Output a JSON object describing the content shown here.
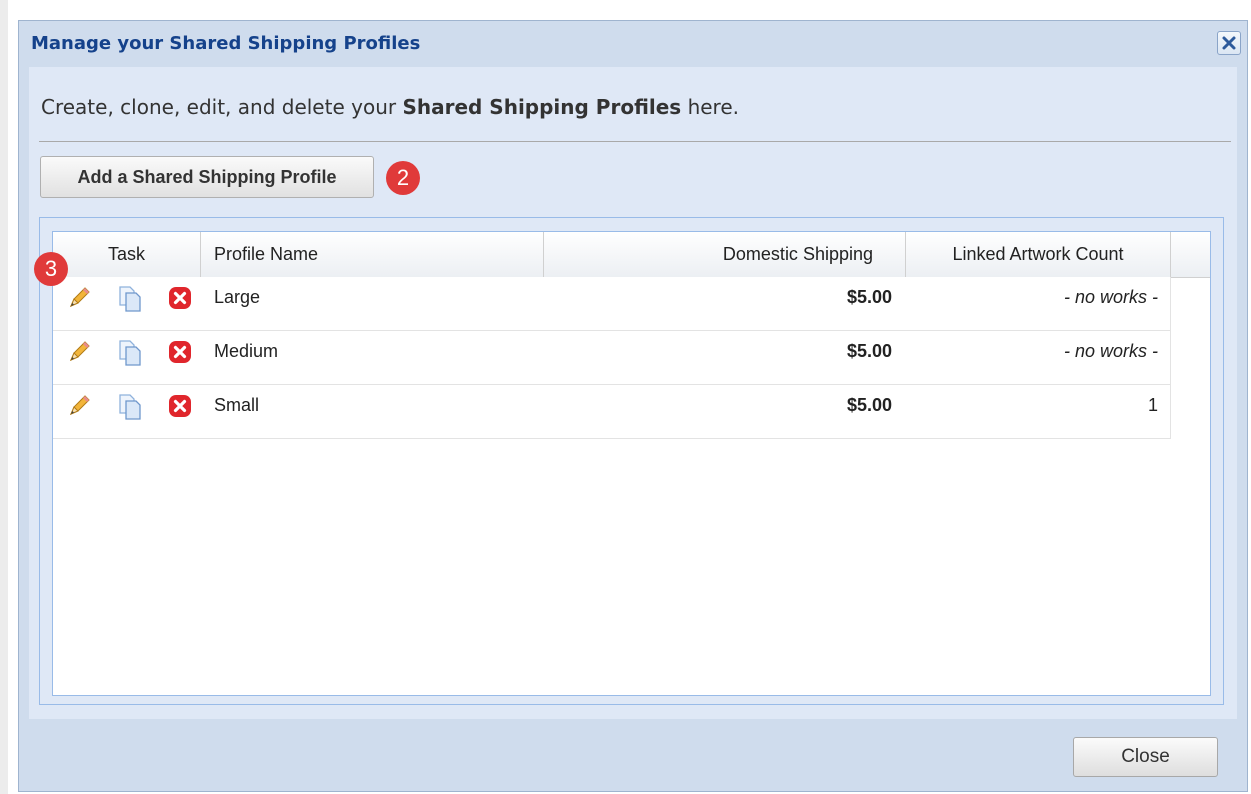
{
  "dialog": {
    "title": "Manage your Shared Shipping Profiles",
    "intro_prefix": "Create, clone, edit, and delete your ",
    "intro_bold": "Shared Shipping Profiles",
    "intro_suffix": " here.",
    "add_button_label": "Add a Shared Shipping Profile",
    "close_button_label": "Close"
  },
  "badges": {
    "add_step": "2",
    "task_step": "3"
  },
  "grid": {
    "columns": [
      "Task",
      "Profile Name",
      "Domestic Shipping",
      "Linked Artwork Count"
    ],
    "rows": [
      {
        "name": "Large",
        "shipping": "$5.00",
        "count": "- no works -"
      },
      {
        "name": "Medium",
        "shipping": "$5.00",
        "count": "- no works -"
      },
      {
        "name": "Small",
        "shipping": "$5.00",
        "count": "1"
      }
    ]
  },
  "icons": {
    "edit": "pencil-icon",
    "clone": "copy-icon",
    "delete": "delete-icon",
    "close": "close-icon"
  },
  "colors": {
    "accent": "#15428b",
    "badge": "#e03a3a",
    "delete": "#e0262c"
  }
}
